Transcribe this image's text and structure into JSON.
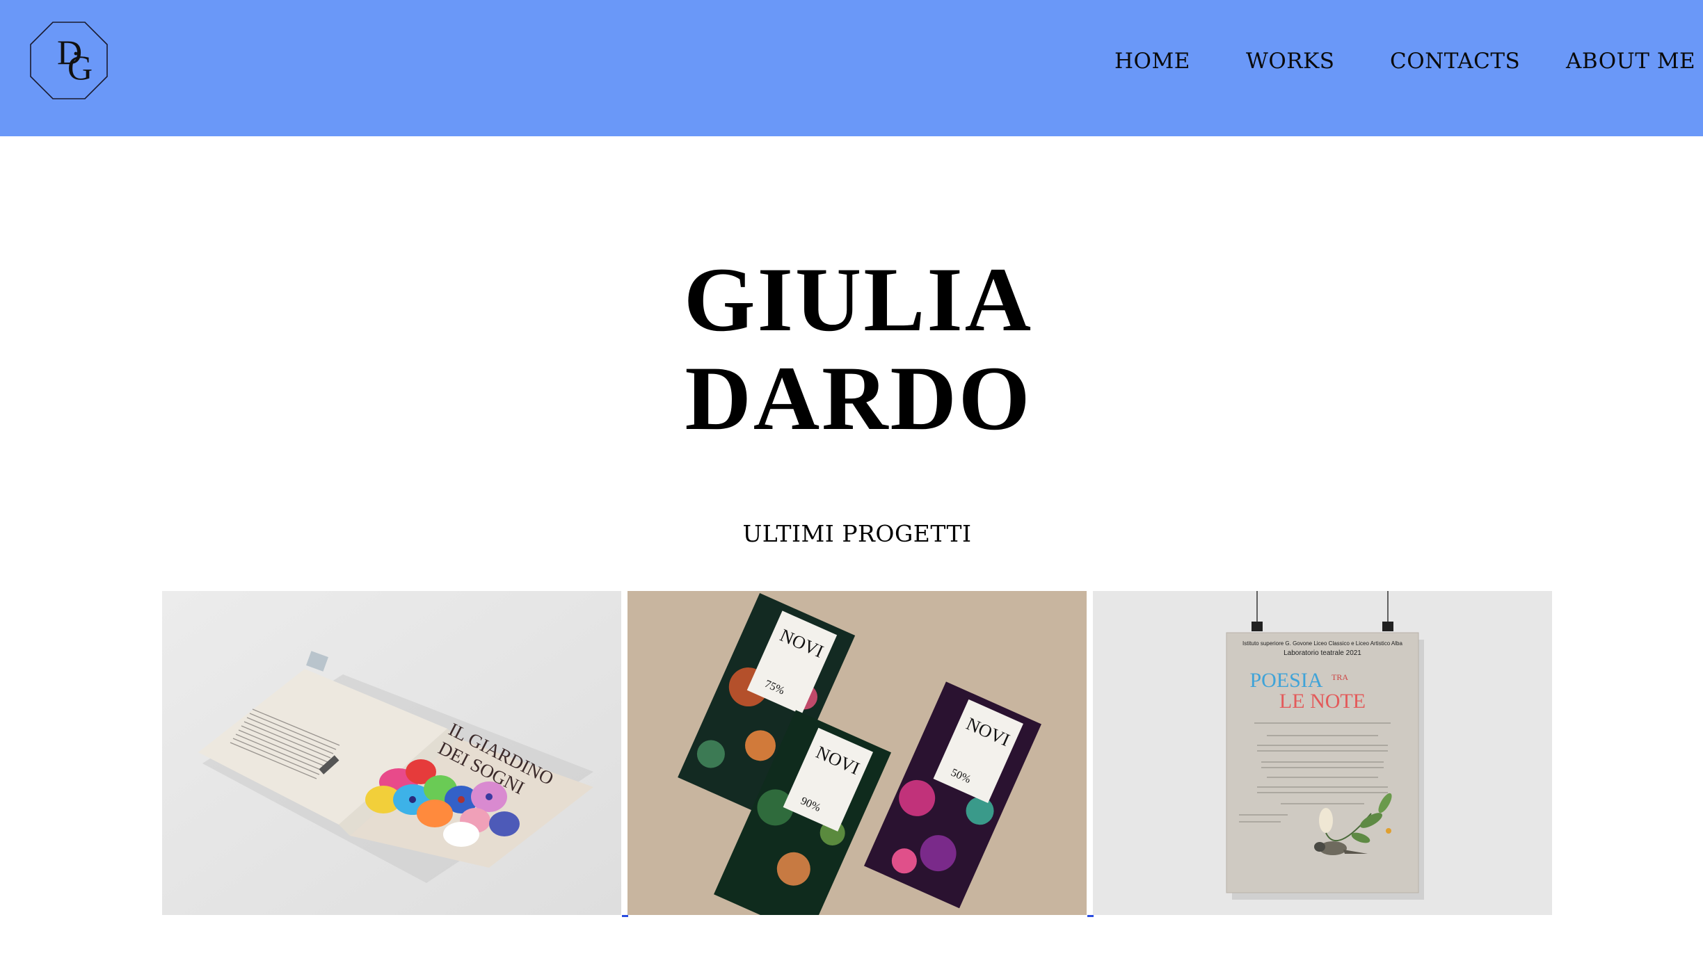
{
  "header": {
    "background": "#6a98f8",
    "logo": {
      "letters_top": "D",
      "letters_bottom": "G",
      "icon": "dg-monogram-logo"
    },
    "nav": [
      {
        "label": "HOME"
      },
      {
        "label": "WORKS"
      },
      {
        "label": "CONTACTS"
      },
      {
        "label": "ABOUT ME"
      }
    ]
  },
  "hero": {
    "line1": "GIULIA",
    "line2": "DARDO"
  },
  "section": {
    "title": "ULTIMI PROGETTI"
  },
  "projects": [
    {
      "image": "book-mockup",
      "cover_title_1": "IL GIARDINO",
      "cover_title_2": "DEI SOGNI"
    },
    {
      "image": "chocolate-packaging-mockup",
      "brand": "NOVI",
      "percents": [
        "75%",
        "90%",
        "50%"
      ]
    },
    {
      "image": "poster-mockup",
      "header_line1": "Istituto superiore G. Govone Liceo Classico e Liceo Artistico Alba",
      "header_line2": "Laboratorio teatrale 2021",
      "title_1": "POESIA",
      "title_tra": "TRA",
      "title_2": "LE NOTE"
    }
  ]
}
